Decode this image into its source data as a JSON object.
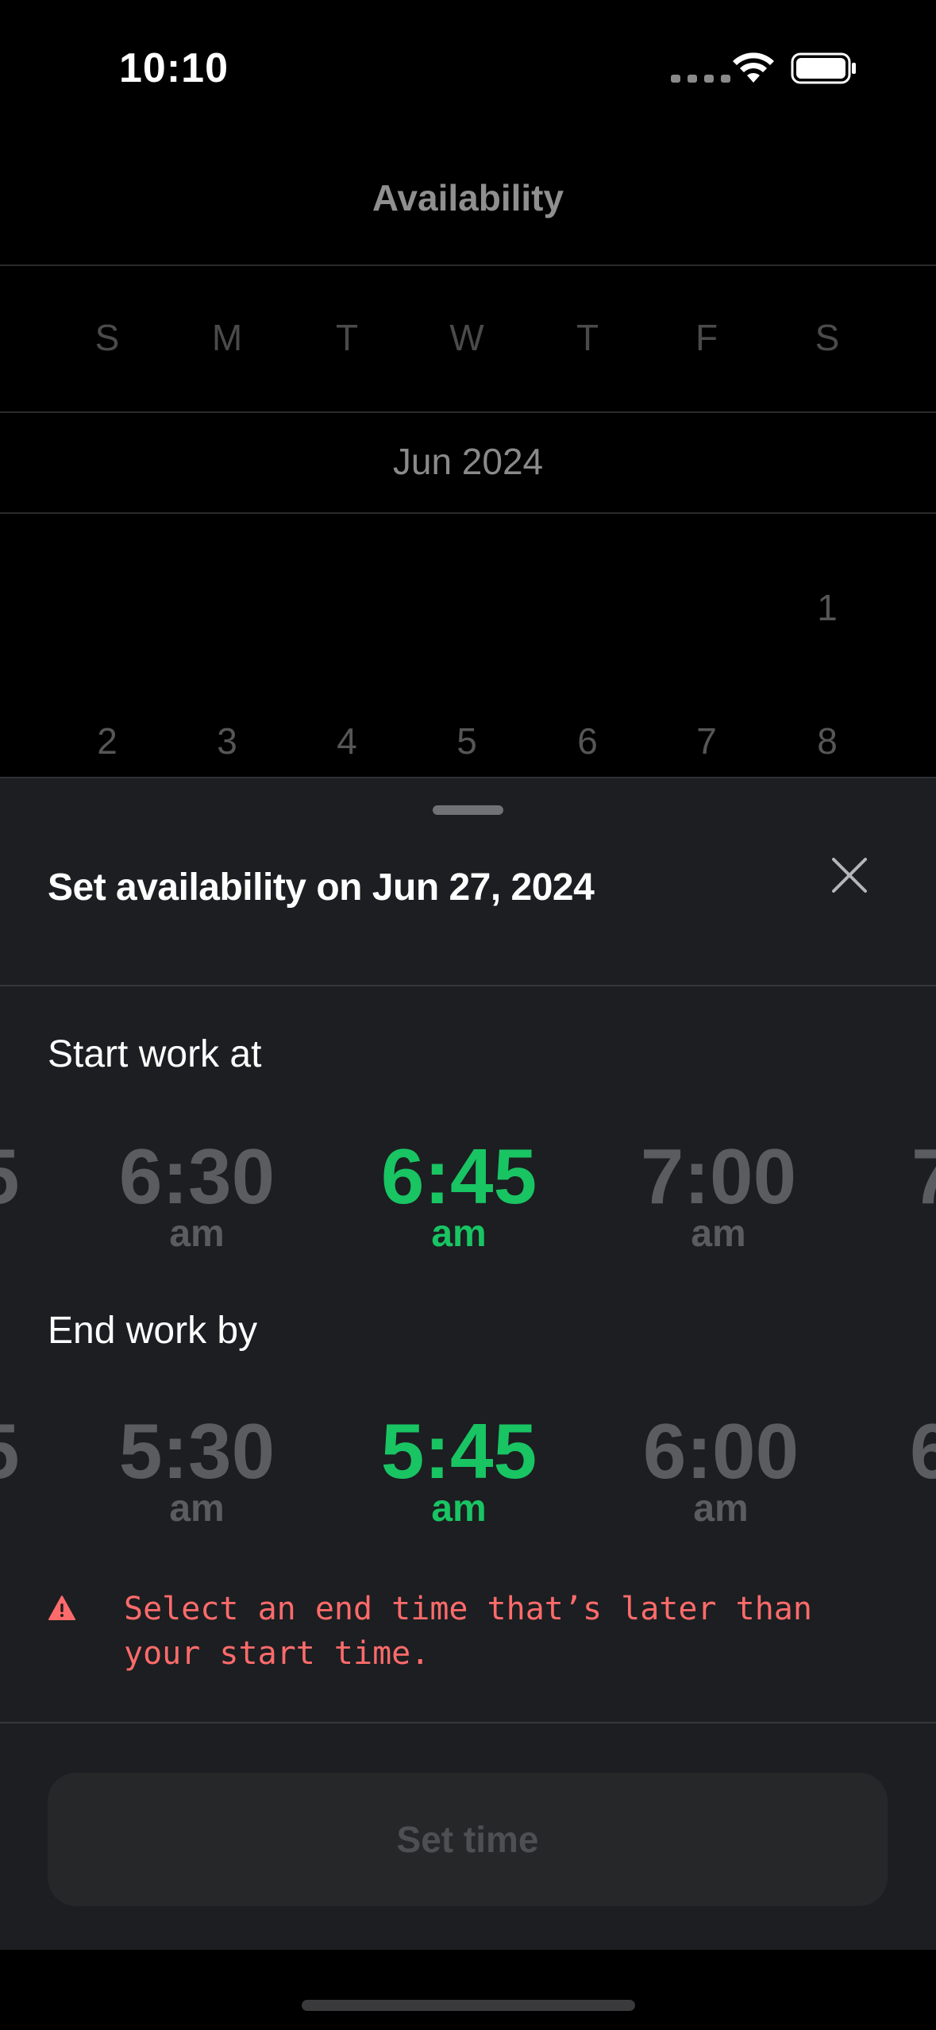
{
  "status_bar": {
    "time": "10:10"
  },
  "background_page": {
    "title": "Availability",
    "weekdays": [
      "S",
      "M",
      "T",
      "W",
      "T",
      "F",
      "S"
    ],
    "month": "Jun 2024",
    "week1": [
      "",
      "",
      "",
      "",
      "",
      "",
      "1"
    ],
    "week2": [
      "2",
      "3",
      "4",
      "5",
      "6",
      "7",
      "8"
    ]
  },
  "sheet": {
    "title": "Set availability on Jun 27, 2024",
    "start": {
      "label": "Start work at",
      "left_peek": "5",
      "options": [
        {
          "time": "6:30",
          "period": "am",
          "selected": false
        },
        {
          "time": "6:45",
          "period": "am",
          "selected": true
        },
        {
          "time": "7:00",
          "period": "am",
          "selected": false
        }
      ],
      "right_peek": "7"
    },
    "end": {
      "label": "End work by",
      "left_peek": "5",
      "options": [
        {
          "time": "5:30",
          "period": "am",
          "selected": false
        },
        {
          "time": "5:45",
          "period": "am",
          "selected": true
        },
        {
          "time": "6:00",
          "period": "am",
          "selected": false
        }
      ],
      "right_peek": "6"
    },
    "error": {
      "line1": "Select an end time that’s later than",
      "line2": "your start time."
    },
    "submit_label": "Set time"
  },
  "colors": {
    "accent": "#19c463",
    "error": "#ff6b6b",
    "sheet_bg": "#1c1e21",
    "inactive_time": "#5b5c5f"
  },
  "icons": [
    "wifi-icon",
    "battery-icon",
    "close-icon",
    "warning-icon"
  ]
}
